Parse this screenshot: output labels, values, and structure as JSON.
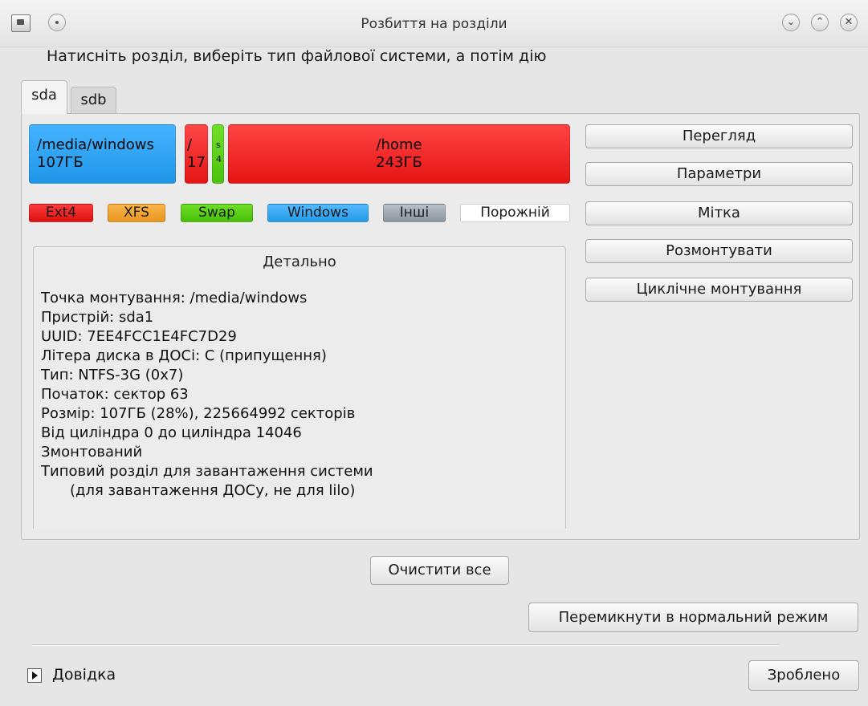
{
  "window": {
    "title": "Розбиття на розділи"
  },
  "instruction": "Натисніть розділ, виберіть тип файлової системи, а потім дію",
  "tabs": [
    {
      "label": "sda"
    },
    {
      "label": "sdb"
    }
  ],
  "partitions": [
    {
      "mount": "/media/windows",
      "size": "107ГБ",
      "color": "#2aa3f5",
      "type": "Windows"
    },
    {
      "mount": "/",
      "size": "17",
      "color": "#ee2222",
      "type": "Ext4"
    },
    {
      "mount": "s",
      "size": "4",
      "color": "#5fd31b",
      "type": "Swap"
    },
    {
      "mount": "/home",
      "size": "243ГБ",
      "color": "#ee2222",
      "type": "Ext4"
    }
  ],
  "legend": [
    {
      "label": "Ext4",
      "color": "#ee2222"
    },
    {
      "label": "XFS",
      "color": "#f2a532"
    },
    {
      "label": "Swap",
      "color": "#5fd31b"
    },
    {
      "label": "Windows",
      "color": "#2aa3f5"
    },
    {
      "label": "Інші",
      "color": "#9aa4ae"
    },
    {
      "label": "Порожній",
      "color": "#ffffff"
    }
  ],
  "details": {
    "title": "Детально",
    "lines": [
      "Точка монтування: /media/windows",
      "Пристрій: sda1",
      "UUID: 7EE4FCC1E4FC7D29",
      "Літера диска в ДОСі: C (припущення)",
      "Тип: NTFS-3G (0x7)",
      "Початок: сектор 63",
      "Розмір: 107ГБ (28%), 225664992 секторів",
      "Від циліндра 0 до циліндра 14046",
      "Змонтований",
      "Типовий розділ для завантаження системи",
      "(для завантаження ДОСу, не для lilo)"
    ]
  },
  "actions": [
    {
      "label": "Перегляд"
    },
    {
      "label": "Параметри"
    },
    {
      "label": "Мітка"
    },
    {
      "label": "Розмонтувати"
    },
    {
      "label": "Циклічне монтування"
    }
  ],
  "buttons": {
    "clear_all": "Очистити все",
    "toggle_mode": "Перемикнути в нормальний режим",
    "done": "Зроблено"
  },
  "help": {
    "label": "Довідка"
  }
}
